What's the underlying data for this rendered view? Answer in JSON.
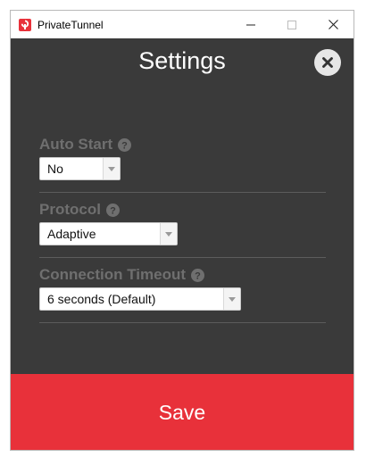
{
  "window": {
    "title": "PrivateTunnel"
  },
  "header": {
    "title": "Settings"
  },
  "settings": [
    {
      "label": "Auto Start",
      "value": "No"
    },
    {
      "label": "Protocol",
      "value": "Adaptive"
    },
    {
      "label": "Connection Timeout",
      "value": "6 seconds (Default)"
    }
  ],
  "footer": {
    "save_label": "Save"
  },
  "colors": {
    "background": "#3a3a3a",
    "accent": "#e8313a",
    "label": "#6f6f6f",
    "title": "#ffffff"
  },
  "icons": {
    "app": "privatetunnel-logo-icon",
    "close": "close-icon",
    "help": "question-circle-icon",
    "dropdown": "chevron-down-icon"
  }
}
